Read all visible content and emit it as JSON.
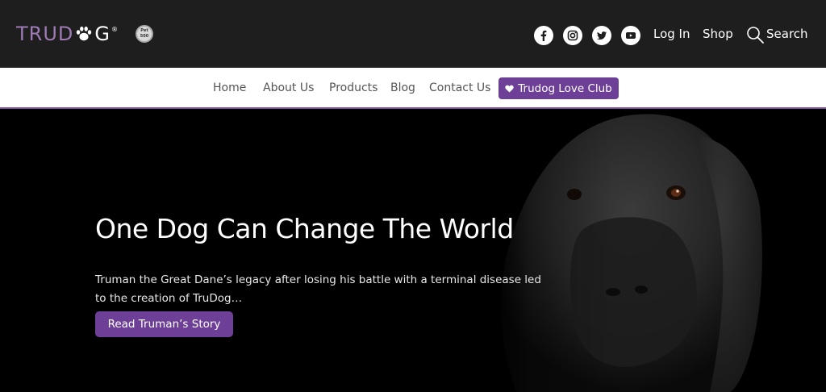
{
  "header": {
    "logo_tru": "TRUD",
    "logo_g": "G",
    "logo_reg": "®",
    "badge_line1": "Pet",
    "badge_line2": "500",
    "social_icons": [
      "facebook-icon",
      "instagram-icon",
      "twitter-icon",
      "youtube-icon"
    ],
    "login_label": "Log In",
    "shop_label": "Shop",
    "search_label": "Search"
  },
  "nav": {
    "items": [
      {
        "label": "Home"
      },
      {
        "label": "About Us"
      },
      {
        "label": "Products"
      },
      {
        "label": "Blog"
      },
      {
        "label": "Contact Us"
      }
    ],
    "love_club_label": "Trudog Love Club"
  },
  "hero": {
    "headline": "One Dog Can Change The World",
    "subtext": "Truman the Great Dane’s legacy after losing his battle with a terminal disease led to the creation of TruDog…",
    "cta_label": "Read Truman’s Story"
  },
  "colors": {
    "topbar": "#1e1e1e",
    "accent_purple": "#6e3f96",
    "logo_purple": "#9e7bb5",
    "nav_text": "#555555"
  }
}
